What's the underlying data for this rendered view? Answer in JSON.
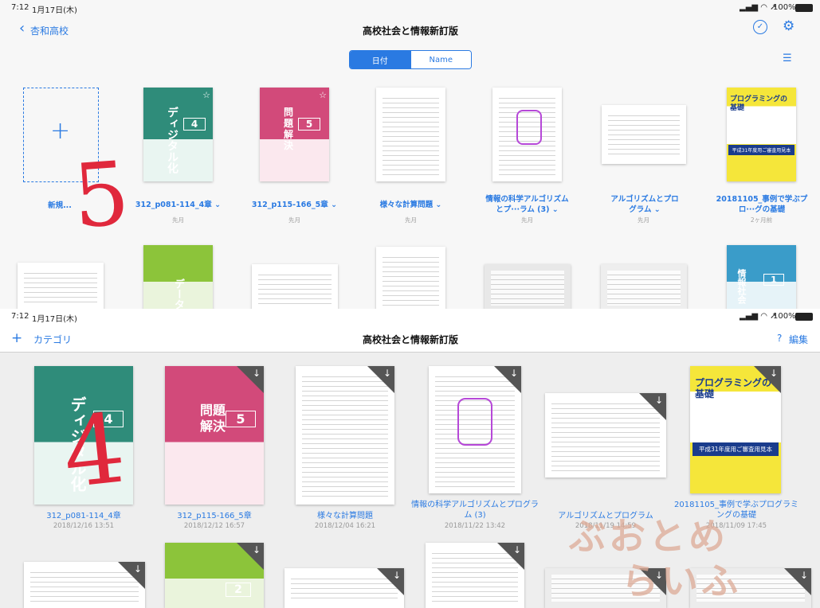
{
  "top": {
    "status": {
      "time": "7:12",
      "date": "1月17日(木)",
      "battery": "100%"
    },
    "nav": {
      "back_label": "杏和高校",
      "title": "高校社会と情報新訂版"
    },
    "segment": {
      "date_label": "日付",
      "name_label": "Name"
    },
    "new_label": "新規...",
    "handwritten_number": "5",
    "items": [
      {
        "title": "312_p081-114_4章",
        "sub": "先月",
        "chapter": "4",
        "cover_text": "ディジタル化"
      },
      {
        "title": "312_p115-166_5章",
        "sub": "先月",
        "chapter": "5",
        "cover_text": "問題解決"
      },
      {
        "title": "様々な計算問題",
        "sub": "先月"
      },
      {
        "title": "情報の科学アルゴリズムとプ···ラム (3)",
        "sub": "先月"
      },
      {
        "title": "アルゴリズムとプログラム",
        "sub": "先月"
      },
      {
        "title": "20181105_事例で学ぶプロ···グの基礎",
        "sub": "2ヶ月前",
        "cover_text": "プログラミングの基礎",
        "banner": "平成31年度用ご審査用見本"
      }
    ],
    "row2_cover_texts": {
      "lime": "データ",
      "cyan": "情報社会",
      "cyan_chapter": "1"
    }
  },
  "bottom": {
    "status": {
      "time": "7:12",
      "date": "1月17日(木)",
      "battery": "100%"
    },
    "nav": {
      "category_label": "カテゴリ",
      "title": "高校社会と情報新訂版",
      "edit_label": "編集",
      "help_label": "?"
    },
    "handwritten_number": "4",
    "items": [
      {
        "title": "312_p081-114_4章",
        "date": "2018/12/16 13:51",
        "chapter": "4",
        "cover_text": "ディジタル化"
      },
      {
        "title": "312_p115-166_5章",
        "date": "2018/12/12 16:57",
        "chapter": "5",
        "cover_text": "問題解決"
      },
      {
        "title": "様々な計算問題",
        "date": "2018/12/04 16:21"
      },
      {
        "title": "情報の科学アルゴリズムとプログラム (3)",
        "date": "2018/11/22 13:42"
      },
      {
        "title": "アルゴリズムとプログラム",
        "date": "2018/11/19 14:59"
      },
      {
        "title": "20181105_事例で学ぶプログラミングの基礎",
        "date": "2018/11/09 17:45",
        "cover_text": "プログラミングの基礎",
        "banner": "平成31年度用ご審査用見本"
      }
    ],
    "row2_chapter": "2",
    "watermark_line1": "ぶおとめ",
    "watermark_line2": "らいふ"
  },
  "colors": {
    "accent": "#2a7ae2",
    "handwriting": "#e0283c"
  },
  "icons": [
    "back-chevron-icon",
    "check-circle-icon",
    "gear-icon",
    "list-icon",
    "plus-icon",
    "download-icon",
    "star-icon",
    "wifi-icon",
    "battery-icon"
  ]
}
